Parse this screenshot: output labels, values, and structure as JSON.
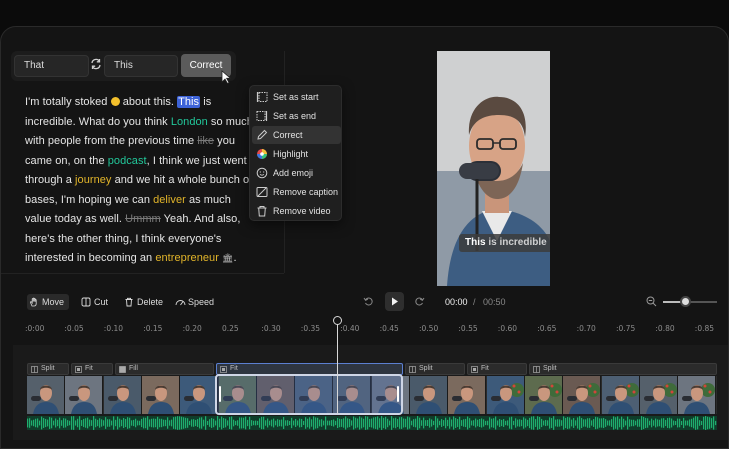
{
  "replace": {
    "find_value": "That",
    "replace_value": "This",
    "correct_label": "Correct"
  },
  "transcript": [
    {
      "t": "I'm totally stoked ",
      "c": ""
    },
    {
      "t": "EMOJI",
      "c": "emoji"
    },
    {
      "t": " about this. ",
      "c": ""
    },
    {
      "t": "This",
      "c": "hl-sel"
    },
    {
      "t": " is incredible. What do you think ",
      "c": ""
    },
    {
      "t": "London",
      "c": "g"
    },
    {
      "t": " so much with people from the previous time ",
      "c": ""
    },
    {
      "t": "like",
      "c": "s"
    },
    {
      "t": " you came on, on the ",
      "c": ""
    },
    {
      "t": "podcast",
      "c": "g"
    },
    {
      "t": ", I think we just went through a ",
      "c": ""
    },
    {
      "t": "journey",
      "c": "y"
    },
    {
      "t": " and we hit a whole bunch of bases, I'm hoping we can ",
      "c": ""
    },
    {
      "t": "deliver",
      "c": "y"
    },
    {
      "t": " as much value today as well. ",
      "c": ""
    },
    {
      "t": "Ummm",
      "c": "s"
    },
    {
      "t": " Yeah. And also, here's the other thing, I think everyone's interested in becoming an ",
      "c": ""
    },
    {
      "t": "entrepreneur",
      "c": "y"
    },
    {
      "t": " ",
      "c": ""
    },
    {
      "t": "🏛",
      "c": "small"
    },
    {
      "t": ".",
      "c": ""
    }
  ],
  "context_menu": [
    {
      "label": "Set as start",
      "icon": "bracket-start-icon"
    },
    {
      "label": "Set as end",
      "icon": "bracket-end-icon"
    },
    {
      "label": "Correct",
      "icon": "pencil-icon",
      "active": true
    },
    {
      "label": "Highlight",
      "icon": "color-wheel-icon"
    },
    {
      "label": "Add emoji",
      "icon": "emoji-add-icon"
    },
    {
      "label": "Remove caption",
      "icon": "caption-remove-icon"
    },
    {
      "label": "Remove video",
      "icon": "trash-icon"
    }
  ],
  "video": {
    "caption_highlight": "This",
    "caption_rest": " is incredible"
  },
  "toolbar": {
    "move": "Move",
    "cut": "Cut",
    "delete": "Delete",
    "speed": "Speed",
    "current_time": "00:00",
    "separator": "/",
    "duration": "00:50"
  },
  "ruler_ticks": [
    ":0:00",
    ":0.05",
    ":0.10",
    ":0.15",
    ":0.20",
    "0.25",
    ":0.30",
    ":0.35",
    ":0.40",
    ":0.45",
    ":0.50",
    ":0.55",
    ":0.60",
    ":0.65",
    ":0.70",
    ":0.75",
    ":0.80",
    ":0.85"
  ],
  "segments": [
    {
      "label": "Split",
      "icon": "split-icon"
    },
    {
      "label": "Fit",
      "icon": "fit-icon"
    },
    {
      "label": "Fill",
      "icon": "fill-icon"
    },
    {
      "label": "Fit",
      "icon": "fit-icon",
      "selected": true
    },
    {
      "label": "Split",
      "icon": "split-icon"
    },
    {
      "label": "Fit",
      "icon": "fit-icon"
    },
    {
      "label": "Split",
      "icon": "split-icon"
    }
  ],
  "colors": {
    "accent_blue": "#3d63d8",
    "keyword_green": "#22c79a",
    "keyword_yellow": "#e2b52a",
    "waveform": "#1fae6e"
  }
}
